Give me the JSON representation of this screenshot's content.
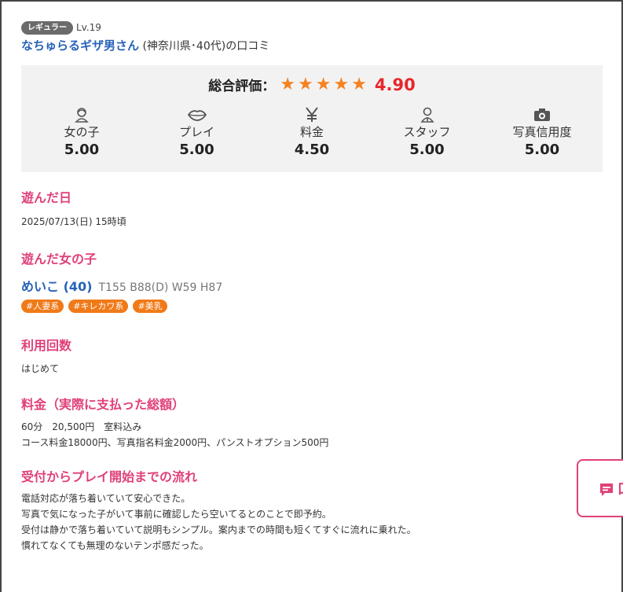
{
  "reviewer": {
    "rank_badge": "レギュラー",
    "level": "Lv.19",
    "name": "なちゅらるギザ男さん",
    "info": " (神奈川県･40代)の口コミ"
  },
  "overall": {
    "label": "総合評価：",
    "score": "4.90",
    "stars": 5,
    "star_color": "#f58220",
    "score_color": "#e8262b"
  },
  "categories": [
    {
      "icon": "girl-icon",
      "label": "女の子",
      "score": "5.00"
    },
    {
      "icon": "lips-icon",
      "label": "プレイ",
      "score": "5.00"
    },
    {
      "icon": "yen-icon",
      "label": "料金",
      "score": "4.50"
    },
    {
      "icon": "staff-icon",
      "label": "スタッフ",
      "score": "5.00"
    },
    {
      "icon": "camera-icon",
      "label": "写真信用度",
      "score": "5.00"
    }
  ],
  "played_date": {
    "title": "遊んだ日",
    "value": "2025/07/13(日) 15時頃"
  },
  "girl": {
    "title": "遊んだ女の子",
    "name": "めいこ",
    "age": "(40)",
    "spec": "T155 B88(D) W59 H87",
    "tags": [
      "#人妻系",
      "#キレカワ系",
      "#美乳"
    ]
  },
  "visits": {
    "title": "利用回数",
    "value": "はじめて"
  },
  "price": {
    "title": "料金（実際に支払った総額）",
    "line1": "60分　20,500円　室料込み",
    "line2": "コース料金18000円、写真指名料金2000円、パンストオプション500円"
  },
  "flow": {
    "title": "受付からプレイ開始までの流れ",
    "lines": [
      "電話対応が落ち着いていて安心できた。",
      "写真で気になった子がいて事前に確認したら空いてるとのことで即予約。",
      "受付は静かで落ち着いていて説明もシンプル。案内までの時間も短くてすぐに流れに乗れた。",
      "慣れてなくても無理のないテンポ感だった。"
    ]
  },
  "side_button": {
    "text": "口"
  },
  "colors": {
    "accent_pink": "#e0407a",
    "link_blue": "#2662b8",
    "tag_orange": "#f07a18",
    "box_gray": "#f2f2f2"
  }
}
